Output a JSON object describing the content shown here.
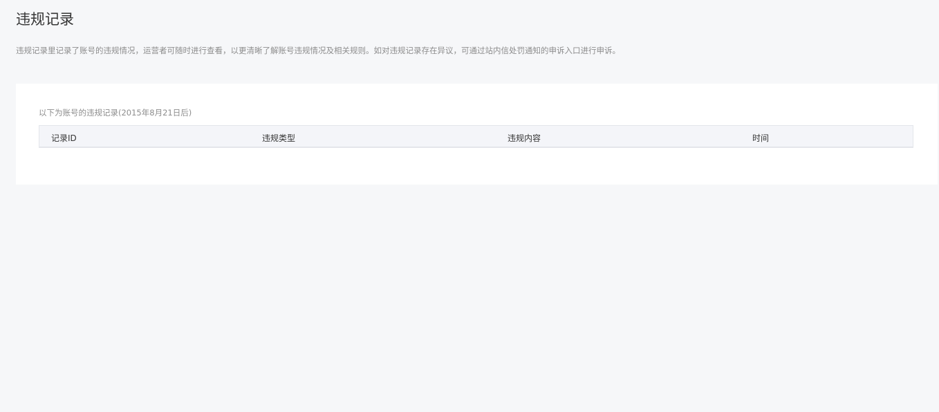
{
  "page": {
    "title": "违规记录",
    "description": "违规记录里记录了账号的违规情况，运营者可随时进行查看，以更清晰了解账号违规情况及相关规则。如对违规记录存在异议，可通过站内信处罚通知的申诉入口进行申诉。"
  },
  "records": {
    "subtitle": "以下为账号的违规记录(2015年8月21日后)",
    "columns": [
      "记录ID",
      "违规类型",
      "违规内容",
      "时间"
    ]
  }
}
